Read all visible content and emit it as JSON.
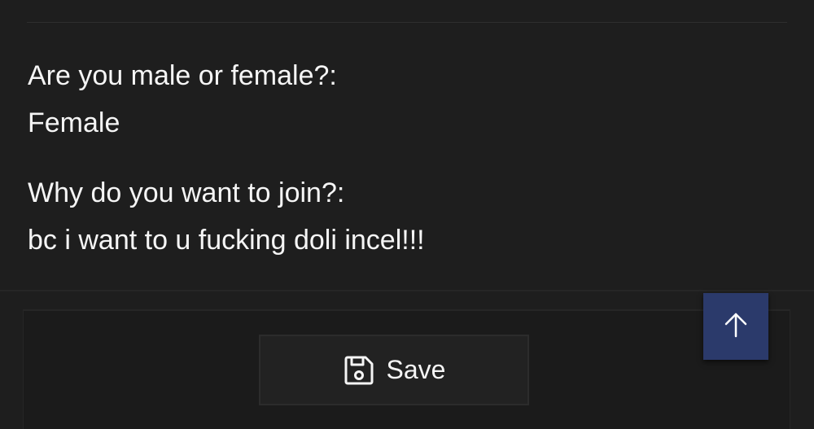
{
  "form": {
    "questions": [
      {
        "label": "Are you male or female?:",
        "answer": "Female"
      },
      {
        "label": "Why do you want to join?:",
        "answer": "bc i want to u fucking doli incel!!!"
      }
    ]
  },
  "footer": {
    "save_label": "Save",
    "save_icon": "floppy-disk-icon"
  },
  "scroll_top": {
    "icon": "arrow-up-icon",
    "color": "#2b3a6b"
  }
}
